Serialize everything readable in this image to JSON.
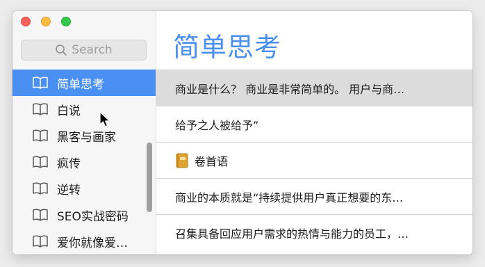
{
  "sidebar": {
    "search": {
      "placeholder": "Search",
      "icon": "search-icon"
    },
    "items": [
      {
        "label": "简单思考",
        "icon": "book-icon",
        "active": true
      },
      {
        "label": "白说",
        "icon": "book-icon"
      },
      {
        "label": "黑客与画家",
        "icon": "book-icon"
      },
      {
        "label": "疯传",
        "icon": "book-icon"
      },
      {
        "label": "逆转",
        "icon": "book-icon"
      },
      {
        "label": "SEO实战密码",
        "icon": "book-icon"
      },
      {
        "label": "爱你就像爱…",
        "icon": "book-icon"
      }
    ]
  },
  "main": {
    "title": "简单思考",
    "rows": [
      {
        "text": "商业是什么？ 商业是非常简单的。 用户与商…",
        "selected": true
      },
      {
        "text": "给予之人被给予”"
      },
      {
        "text": "卷首语",
        "icon": "notebook-icon"
      },
      {
        "text": "商业的本质就是“持续提供用户真正想要的东…"
      },
      {
        "text": "召集具备回应用户需求的热情与能力的员工，…"
      }
    ]
  },
  "colors": {
    "accent": "#4a90f2",
    "selected_row": "#dcdcdc",
    "traffic_red": "#fc605c",
    "traffic_yellow": "#fdbc40",
    "traffic_green": "#34c84a"
  }
}
